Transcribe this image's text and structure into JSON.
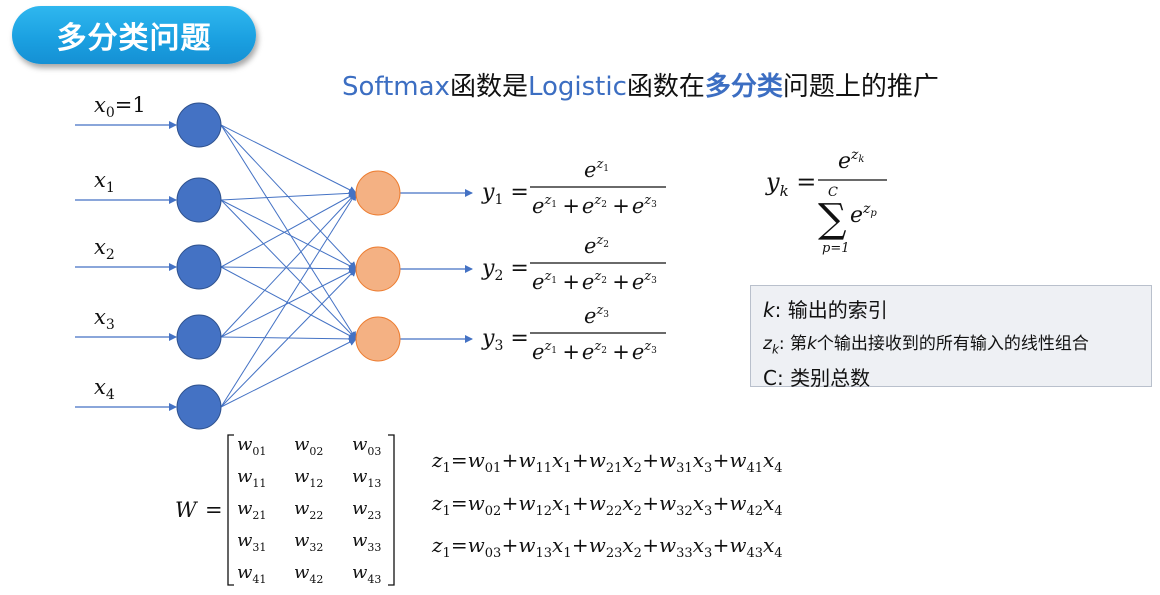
{
  "header": {
    "title": "多分类问题"
  },
  "subtitle": {
    "part1": "Softmax",
    "part2": "函数是",
    "part3": "Logistic",
    "part4": "函数在",
    "part5": "多分类",
    "part6": "问题上的推广"
  },
  "inputs": [
    {
      "sym": "x",
      "sub": "0",
      "extra": "=1"
    },
    {
      "sym": "x",
      "sub": "1",
      "extra": ""
    },
    {
      "sym": "x",
      "sub": "2",
      "extra": ""
    },
    {
      "sym": "x",
      "sub": "3",
      "extra": ""
    },
    {
      "sym": "x",
      "sub": "4",
      "extra": ""
    }
  ],
  "outputs": [
    {
      "sym": "y",
      "sub": "1",
      "num_sup": "1"
    },
    {
      "sym": "y",
      "sub": "2",
      "num_sup": "2"
    },
    {
      "sym": "y",
      "sub": "3",
      "num_sup": "3"
    }
  ],
  "general_formula": {
    "lhs_sym": "y",
    "lhs_sub": "k",
    "num_sup": "k",
    "sum_top": "C",
    "sum_bottom": "p=1",
    "den_sup": "p"
  },
  "legend": {
    "k_sym": "k",
    "k_text": ": 输出的索引",
    "zk_sym": "z",
    "zk_sub": "k",
    "zk_text_a": ": 第",
    "zk_text_k": "k",
    "zk_text_b": "个输出接收到的所有输入的线性组合",
    "c_sym": "C",
    "c_text": ": 类别总数"
  },
  "matrix": {
    "label": "W",
    "rows": [
      [
        "01",
        "02",
        "03"
      ],
      [
        "11",
        "12",
        "13"
      ],
      [
        "21",
        "22",
        "23"
      ],
      [
        "31",
        "32",
        "33"
      ],
      [
        "41",
        "42",
        "43"
      ]
    ]
  },
  "linear_eqs": [
    {
      "lhs": "1",
      "w": [
        "01",
        "11",
        "21",
        "31",
        "41"
      ]
    },
    {
      "lhs": "1",
      "w": [
        "02",
        "12",
        "22",
        "32",
        "42"
      ]
    },
    {
      "lhs": "1",
      "w": [
        "03",
        "13",
        "23",
        "33",
        "43"
      ]
    }
  ],
  "colors": {
    "input_node": "#4472c4",
    "output_node": "#f4b183",
    "edge": "#4472c4",
    "accent": "#3c6ec2"
  }
}
